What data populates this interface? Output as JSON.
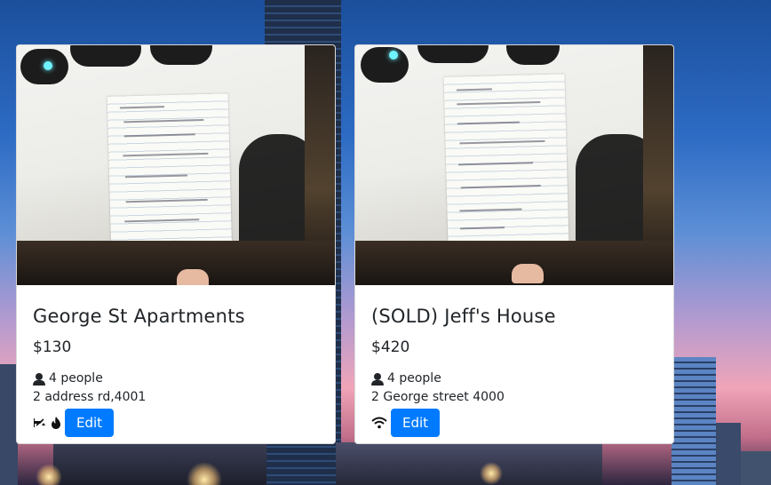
{
  "listings": [
    {
      "title": "George St Apartments",
      "price": "$130",
      "people": "4 people",
      "address": "2 address rd,4001",
      "amenity_icons": [
        "no-smoking-icon",
        "flame-icon"
      ],
      "edit_label": "Edit"
    },
    {
      "title": "(SOLD) Jeff's House",
      "price": "$420",
      "people": "4 people",
      "address": "2 George street 4000",
      "amenity_icons": [
        "wifi-icon"
      ],
      "edit_label": "Edit"
    }
  ],
  "colors": {
    "button": "#007bff",
    "card": "#ffffff",
    "text": "#212529"
  }
}
